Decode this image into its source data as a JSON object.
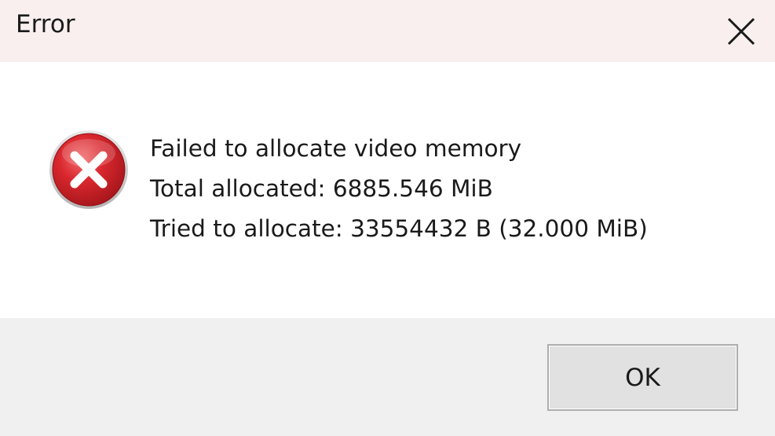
{
  "window": {
    "title": "Error",
    "close_icon": "close-icon"
  },
  "content": {
    "icon": "error-icon",
    "icon_colors": {
      "red": "#d9272e",
      "dark_red": "#a3161b",
      "cross": "#ffffff"
    },
    "lines": [
      "Failed to allocate video memory",
      "Total allocated: 6885.546 MiB",
      "Tried to allocate: 33554432 B (32.000 MiB)"
    ]
  },
  "footer": {
    "ok_label": "OK"
  },
  "colors": {
    "titlebar_bg": "#f9efef",
    "content_bg": "#ffffff",
    "footer_bg": "#f0f0f0",
    "button_bg": "#e1e1e1",
    "button_border": "#adadad"
  }
}
